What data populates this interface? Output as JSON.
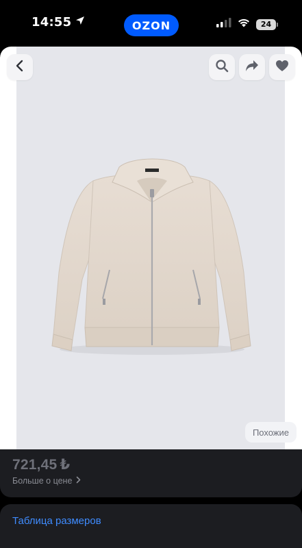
{
  "status_bar": {
    "time": "14:55",
    "location_icon": "location-arrow-icon",
    "app_pill": "OZON",
    "app_pill_color": "#005bff",
    "signal_icon": "cellular-signal-icon",
    "wifi_icon": "wifi-icon",
    "battery_level": "24"
  },
  "product": {
    "image_description_icon": "jacket-photo",
    "top_bar": {
      "back_icon": "chevron-left-icon",
      "search_icon": "search-icon",
      "share_icon": "share-arrow-icon",
      "favorite_icon": "heart-icon"
    },
    "similar_label": "Похожие",
    "price": "721,45",
    "currency_symbol": "₺",
    "price_details_label": "Больше о цене",
    "size_table_label": "Таблица размеров"
  },
  "colors": {
    "background": "#000000",
    "card": "#1c1d21",
    "link": "#3f8cff",
    "muted_text": "#6e7079"
  }
}
